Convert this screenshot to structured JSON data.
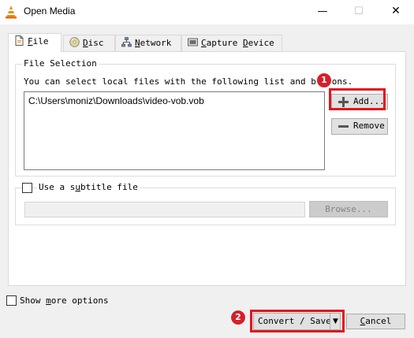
{
  "window": {
    "title": "Open Media",
    "minimize": "—",
    "maximize": "☐",
    "close": "✕"
  },
  "tabs": [
    {
      "label": "File",
      "mnemonic": "F",
      "rest": "ile",
      "icon": "file-icon",
      "active": true
    },
    {
      "label": "Disc",
      "mnemonic": "D",
      "rest": "isc",
      "icon": "disc-icon",
      "active": false
    },
    {
      "label": "Network",
      "mnemonic": "N",
      "rest": "etwork",
      "icon": "network-icon",
      "active": false
    },
    {
      "label": "Capture Device",
      "pre": "",
      "mnemonic": "C",
      "rest": "apture ",
      "mnemonic2": "D",
      "rest2": "evice",
      "icon": "capture-device-icon",
      "active": false
    }
  ],
  "file_selection": {
    "legend": "File Selection",
    "instructions": "You can select local files with the following list and buttons.",
    "files": [
      "C:\\Users\\moniz\\Downloads\\video-vob.vob"
    ],
    "add_label": "Add...",
    "remove_label": "Remove"
  },
  "subtitle": {
    "label_pre": "Use a s",
    "label_mn": "u",
    "label_post": "btitle file",
    "checked": false,
    "path": "",
    "browse_label": "Browse..."
  },
  "options": {
    "more_pre": "Show ",
    "more_mn": "m",
    "more_post": "ore options",
    "checked": false
  },
  "footer": {
    "convert_label": "Convert / Save",
    "cancel_mn": "C",
    "cancel_rest": "ancel"
  },
  "annotations": {
    "marker1": "1",
    "marker2": "2",
    "highlight_color": "#e2141d"
  }
}
